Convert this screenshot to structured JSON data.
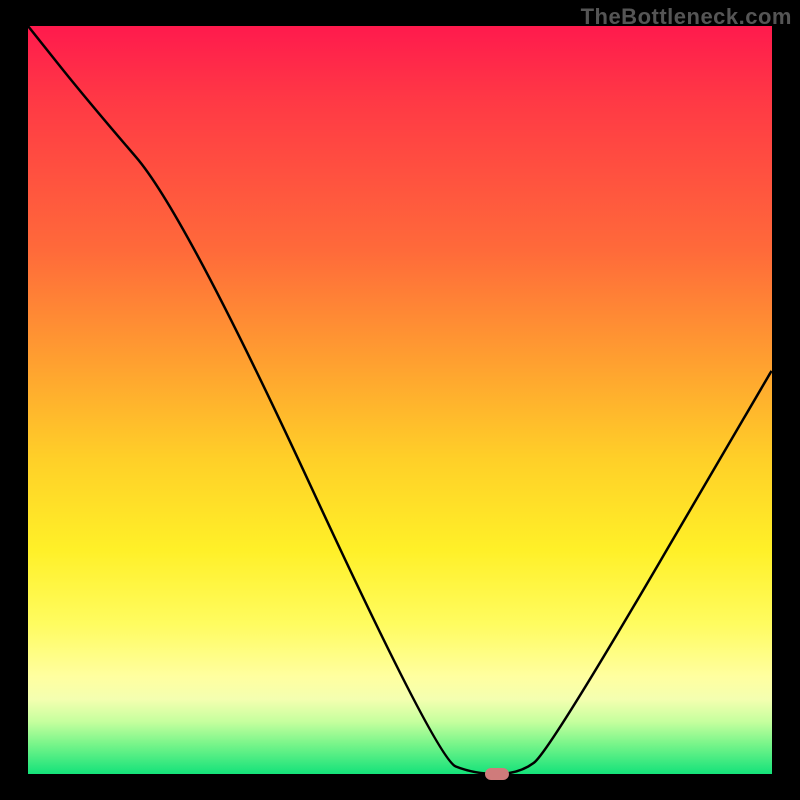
{
  "watermark": "TheBottleneck.com",
  "chart_data": {
    "type": "line",
    "title": "",
    "xlabel": "",
    "ylabel": "",
    "xlim": [
      0,
      100
    ],
    "ylim": [
      0,
      100
    ],
    "grid": false,
    "series": [
      {
        "name": "bottleneck-curve",
        "x": [
          0,
          8,
          21,
          55,
          60,
          66,
          70,
          100
        ],
        "y": [
          100,
          90,
          75,
          2,
          0,
          0,
          3,
          54
        ]
      }
    ],
    "marker": {
      "x": 63,
      "y": 0,
      "name": "optimal-point"
    },
    "background_gradient": {
      "stops": [
        {
          "pos": 0,
          "color": "#ff1a4d"
        },
        {
          "pos": 30,
          "color": "#ff6a3a"
        },
        {
          "pos": 58,
          "color": "#ffd028"
        },
        {
          "pos": 80,
          "color": "#fffc60"
        },
        {
          "pos": 93,
          "color": "#c6ff9e"
        },
        {
          "pos": 100,
          "color": "#14e27a"
        }
      ]
    }
  },
  "colors": {
    "curve": "#000000",
    "marker": "#cf7b7b",
    "frame_bg": "#000000",
    "watermark": "#555555"
  }
}
